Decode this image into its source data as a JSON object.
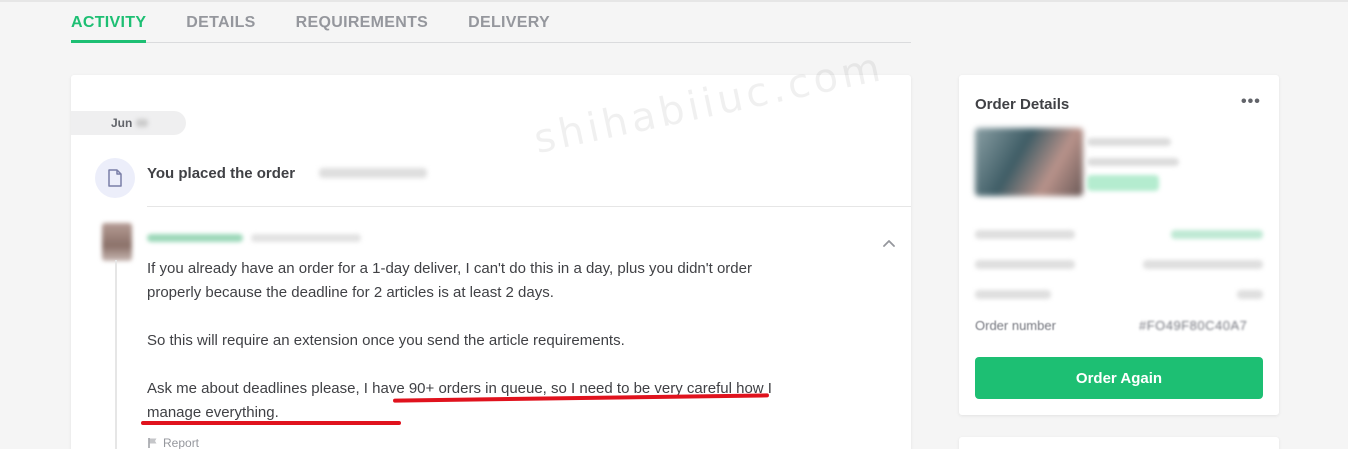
{
  "tabs": [
    {
      "label": "ACTIVITY",
      "active": true
    },
    {
      "label": "DETAILS",
      "active": false
    },
    {
      "label": "REQUIREMENTS",
      "active": false
    },
    {
      "label": "DELIVERY",
      "active": false
    }
  ],
  "activity": {
    "date_label": "Jun",
    "placed_event": "You placed the order",
    "message": {
      "paragraphs": [
        "If you already have an order for a 1-day deliver, I can't do this in a day, plus you didn't order properly because the deadline for 2 articles is at least 2 days.",
        "So this will require an extension once you send the article requirements.",
        "Ask me about deadlines please, I have 90+ orders in queue, so I need to be very careful how I manage everything."
      ],
      "report_label": "Report"
    },
    "watermark": "shihabiiuc.com"
  },
  "order_details": {
    "title": "Order Details",
    "more_label": "•••",
    "order_number_label": "Order number",
    "order_number_value": "#FO49F80C40A7",
    "order_again_label": "Order Again"
  },
  "colors": {
    "accent": "#1dbf73",
    "highlight_underline": "#e0121d"
  },
  "icons": {
    "placed": "document-icon",
    "collapse": "chevron-up-icon",
    "report": "flag-icon",
    "more": "more-horizontal-icon"
  }
}
